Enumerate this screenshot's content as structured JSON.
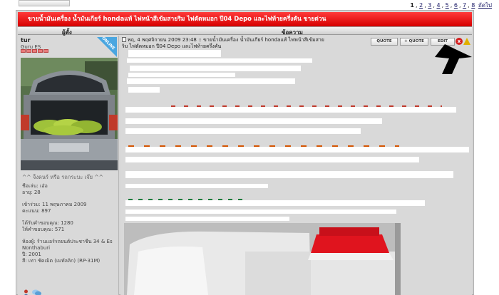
{
  "pagination": {
    "pages": [
      "1",
      "2",
      "3",
      "4",
      "5",
      "6",
      "7",
      "8"
    ],
    "next_label": "ถัดไป"
  },
  "thread": {
    "title": "ขายน้ำมันเครื่อง น้ำมันเกียร์ hondaแท้ ไฟหน้าสีเข้มสายริม ไฟตัดหมอก ปี04 Depo และไฟท้ายครึ่งคัน ขายด่วน"
  },
  "table_header": {
    "author": "ผู้ตั้ง",
    "message": "ข้อความ"
  },
  "author": {
    "username": "tur",
    "rank": "Guru ES",
    "online_badge": "ONLINE",
    "signature_link": "^^ จิ้งดนร์ หรือ รถกระบะ เจ๊ย ^^",
    "name": "ชื่อเล่น: เอ๋อ",
    "age": "อายุ: 28",
    "joined": "เข้าร่วม: 11 พฤษภาคม 2009",
    "points": "คะแนน: 897",
    "likes_received": "ได้รับคำขอบคุณ: 1280",
    "likes_given": "ให้คำขอบคุณ: 571",
    "shop": "ห้องผู้: ร้านแอร์รถยนต์ประชาชื่น 34 & Es",
    "location": "Nonthaburi",
    "year": "ปี: 2001",
    "color": "สี: เทา ชัคเม็ต (เมทัลลิก) (RP-31M)"
  },
  "post": {
    "meta_line1": "พฤ, 4 พฤศจิกายน 2009 23:48 :: ขายน้ำมันเครื่อง น้ำมันเกียร์ hondaแท้ ไฟหน้าสีเข้มสาย",
    "meta_line2": "ริม ไฟตัดหมอก ปี04 Depo และไฟท้ายครึ่งคัน",
    "quote_label": "QUOTE",
    "multiquote_label": "+ QUOTE",
    "edit_label": "EDIT"
  },
  "icons": {
    "delete": "x",
    "warn": "warning-icon"
  },
  "colors": {
    "title_bar": "#d60000",
    "online_badge": "#4aa6e0",
    "product_cap": "#e0141e"
  }
}
